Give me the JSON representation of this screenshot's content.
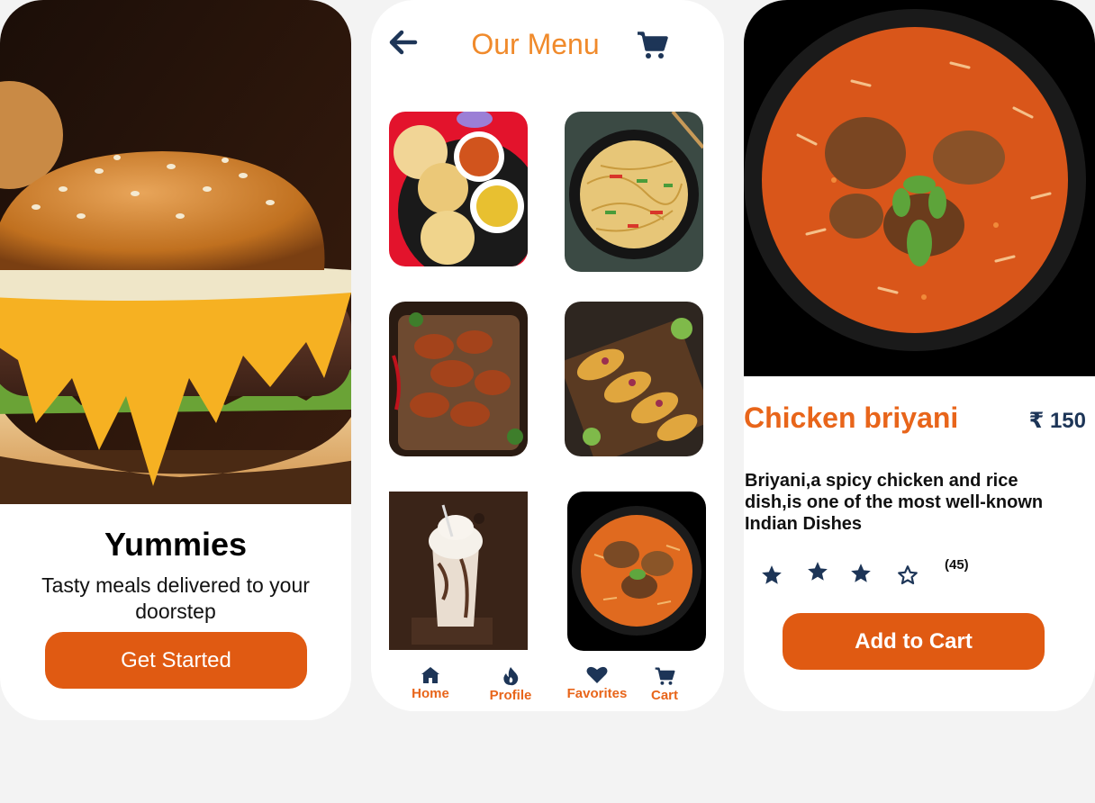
{
  "welcome": {
    "title": "Yummies",
    "subtitle": "Tasty meals delivered to your doorstep",
    "cta_label": "Get Started"
  },
  "menu": {
    "title": "Our Menu",
    "items": [
      {
        "name": "poori-curry-image"
      },
      {
        "name": "noodles-image"
      },
      {
        "name": "chicken-wings-image"
      },
      {
        "name": "tacos-image"
      },
      {
        "name": "milkshake-image"
      },
      {
        "name": "biryani-image"
      }
    ],
    "nav": [
      {
        "label": "Home",
        "icon": "home-icon"
      },
      {
        "label": "Profile",
        "icon": "flame-icon"
      },
      {
        "label": "Favorites",
        "icon": "heart-icon"
      },
      {
        "label": "Cart",
        "icon": "cart-icon"
      }
    ]
  },
  "detail": {
    "name": "Chicken briyani",
    "price": "₹ 150",
    "description": "Briyani,a spicy chicken and rice dish,is one of the most well-known Indian Dishes",
    "rating": 3,
    "rating_max": 4,
    "review_count": "(45)",
    "cta_label": "Add to Cart"
  },
  "colors": {
    "accent": "#e05a12",
    "title_orange": "#f08a2b",
    "navy": "#1d3557",
    "background": "#f3f3f3"
  }
}
